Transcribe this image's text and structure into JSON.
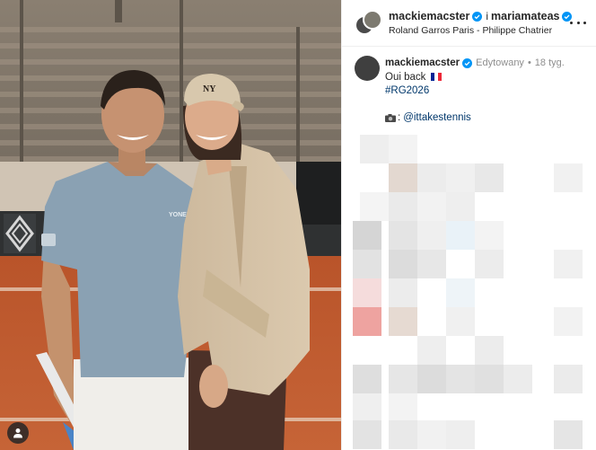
{
  "post": {
    "author": "mackiemacster",
    "coauthor": "mariamateas",
    "joiner": "i",
    "location": "Roland Garros Paris - Philippe Chatrier"
  },
  "caption": {
    "username": "mackiemacster",
    "edited": "Edytowany",
    "dot": "•",
    "age": "18 tyg.",
    "text": "Oui back",
    "hashtag": "#RG2026",
    "credit_prefix": ":",
    "credit_handle": "@ittakestennis"
  },
  "photo": {
    "cap_logo": "NY",
    "shirt_logo": "YONEX"
  },
  "colors": {
    "verified": "#0095f6",
    "link": "#00376b",
    "muted": "#8e8e8e",
    "clay": "#c2592b"
  },
  "icons": {
    "user_tag": "person-icon",
    "verified": "verified-badge-icon",
    "more": "more-options-icon",
    "flag": "france-flag-icon",
    "camera": "camera-icon"
  }
}
